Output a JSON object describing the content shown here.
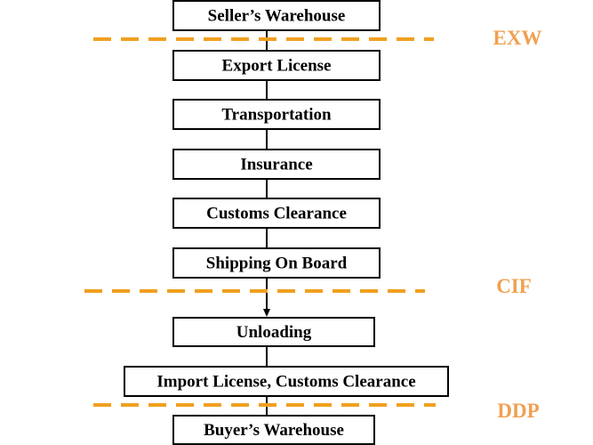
{
  "steps": [
    {
      "label": "Seller’s Warehouse"
    },
    {
      "label": "Export License"
    },
    {
      "label": "Transportation"
    },
    {
      "label": "Insurance"
    },
    {
      "label": "Customs Clearance"
    },
    {
      "label": "Shipping On Board"
    },
    {
      "label": "Unloading"
    },
    {
      "label": "Import License, Customs Clearance"
    },
    {
      "label": "Buyer’s Warehouse"
    }
  ],
  "terms": [
    {
      "label": "EXW",
      "after_step": "Seller’s Warehouse"
    },
    {
      "label": "CIF",
      "after_step": "Shipping On Board"
    },
    {
      "label": "DDP",
      "after_step": "Import License, Customs Clearance"
    }
  ],
  "colors": {
    "divider": "#f0a020",
    "term_label": "#f0a050",
    "box_border": "#000000"
  }
}
